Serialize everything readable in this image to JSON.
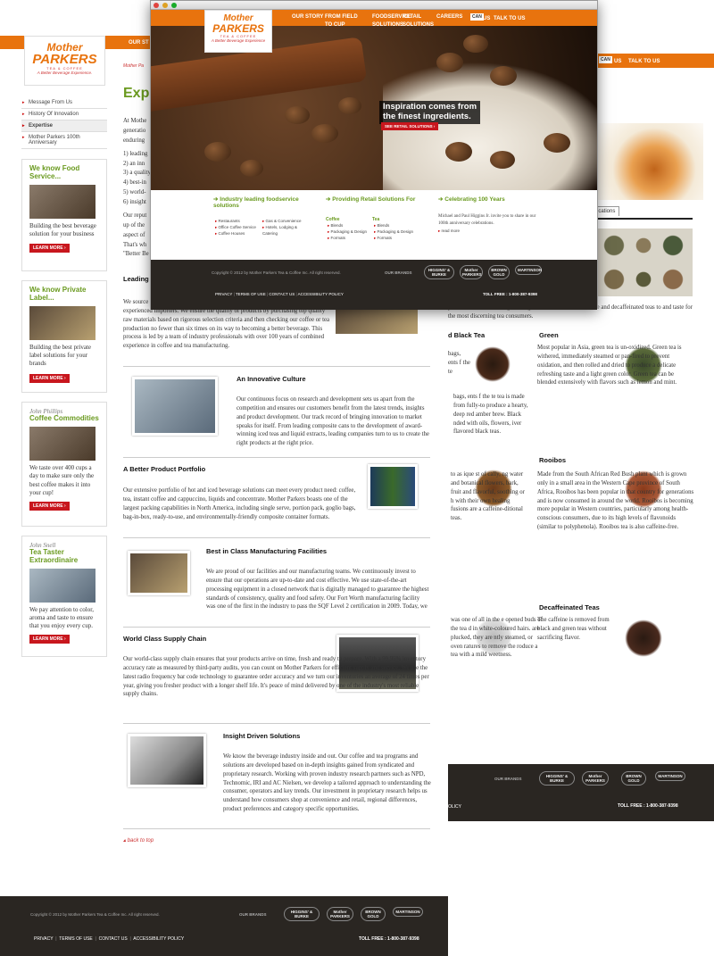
{
  "back_page": {
    "nav": {
      "our_story": "OUR ST",
      "can": "CAN",
      "us": "US",
      "talk": "TALK TO US"
    },
    "logo": {
      "line1": "Mother",
      "line2": "PARKERS",
      "line3": "TEA & COFFEE",
      "tagline": "A Better Beverage Experience."
    },
    "breadcrumb": "Mother Pa",
    "heading": "Expe",
    "side_menu": [
      "Message From Us",
      "History Of Innovation",
      "Expertise",
      "Mother Parkers 100th Anniversary"
    ],
    "promos": [
      {
        "title": "We know Food Service...",
        "who": "",
        "text": "Building the best beverage solution for your business",
        "btn": "LEARN MORE ›"
      },
      {
        "title": "We know Private Label...",
        "who": "",
        "text": "Building the best private label solutions for your brands",
        "btn": "LEARN MORE ›"
      },
      {
        "title": "Coffee Commodities",
        "who": "John Phillips",
        "text": "We taste over 400 cups a day to make sure only the best coffee makes it into your cup!",
        "btn": "LEARN MORE ›"
      },
      {
        "title": "Tea Taster Extraordinaire",
        "who": "John Snell",
        "text": "We pay attention to color, aroma and taste to ensure that you enjoy every cup.",
        "btn": "LEARN MORE ›"
      }
    ],
    "intro_lines": [
      "At Mothe",
      "generatio",
      "enduring",
      "1) leading",
      "2) an inn",
      "3) a quality",
      "4) best-in",
      "5) world-",
      "6) insight",
      "Our reput",
      "up of the",
      "aspect of",
      "That's wh",
      "\"Better Be"
    ],
    "leading_head": "Leading",
    "leading_text": "We source ... Mother Parkers chooses to deal with the most respected and experienced importers. We ensure the quality of products by purchasing top quality raw materials based on rigorous selection criteria and then checking our coffee or tea production no fewer than six times on its way to becoming a better beverage. This process is led by a team of industry professionals with over 100 years of combined experience in coffee and tea manufacturing.",
    "sections": [
      {
        "head": "An Innovative Culture",
        "text": "Our continuous focus on research and development sets us apart from the competition and ensures our customers benefit from the latest trends, insights and product development. Our track record of bringing innovation to market speaks for itself. From leading composite cans to the development of award-winning iced teas and liquid extracts, leading companies turn to us to create the right products at the right price."
      },
      {
        "head": "A Better Product Portfolio",
        "text": "Our extensive portfolio of hot and iced beverage solutions can meet every product need: coffee, tea, instant coffee and cappuccino, liquids and concentrate. Mother Parkers boasts one of the largest packing capabilities in North America, including single serve, portion pack, goglio bags, bag-in-box, ready-to-use, and environmentally-friendly composite container formats."
      },
      {
        "head": "Best in Class Manufacturing Facilities",
        "text": "We are proud of our facilities and our manufacturing teams. We continuously invest to ensure that our operations are up-to-date and cost effective. We use state-of-the-art processing equipment in a closed network that is digitally managed to guarantee the highest standards of consistency, quality and food safety. Our Fort Worth manufacturing facility was one of the first in the industry to pass the SQF Level 2 certification in 2009. Today, we are proud to provide this global quality recognition in each and every Mother Parkers facility."
      },
      {
        "head": "World Class Supply Chain",
        "text": "Our world-class supply chain ensures that your products arrive on time, fresh and ready to prepare. With a 99.95% inventory accuracy rate as measured by third-party audits, you can count on Mother Parkers for efficient supply and service. We use the latest radio frequency bar code technology to guarantee order accuracy and we turn our inventories an average of 24 times per year, giving you fresher product with a longer shelf life. It's peace of mind delivered by one of the industry's most reliable supply chains."
      },
      {
        "head": "Insight Driven Solutions",
        "text": "We know the beverage industry inside and out. Our coffee and tea programs and solutions are developed based on in-depth insights gained from syndicated and proprietary research. Working with proven industry research partners such as NPD, Technomic, IRI and AC Nielsen, we develop a tailored approach to understanding the consumer, operators and key trends. Our investment in proprietary research helps us understand how consumers shop at convenience and retail, regional differences, product preferences and category specific opportunities."
      }
    ],
    "back_to_top": "back to top",
    "footer": {
      "copy": "Copyright © 2012 by Mother Parkers Tea & Coffee Inc. All right reserved.",
      "our_brands": "OUR BRANDS",
      "links": [
        "PRIVACY",
        "TERMS OF USE",
        "CONTACT US",
        "ACCESSIBILITY POLICY"
      ],
      "toll": "TOLL FREE : 1-800-387-9398",
      "brands": [
        "HIGGINS' & BURKE",
        "Mother PARKERS",
        "BROWN GOLD",
        "MARTINSON"
      ]
    }
  },
  "right_page": {
    "nav": {
      "can": "CAN",
      "us": "US",
      "talk": "TALK TO US"
    },
    "tab": "ications",
    "intro": "y and science of blending black, green, herbals, rooibos, white and decaffeinated teas to and taste for the most discerning tea consumers.",
    "black_head": "d Black Tea",
    "black_text": "bags, ents f the te tea is made from fully-to produce a hearty, deep red amber brew. Black nded with oils, flowers, iver flavored black teas.",
    "green_head": "Green",
    "green_text": "Most popular in Asia, green tea is un-oxidized. Green tea is withered, immediately steamed or pan-fired to prevent oxidation, and then rolled and dried to produce a delicate refreshing taste and a light green color. Green tea can be blended extensively with flavors such as lemon and mint.",
    "herbal_text": "to as ique st of cally, ng water and botanical flowers, bark, fruit and flavorful, soothing or h with their own healing fusions are a caffeine-ditional teas.",
    "rooibos_head": "Rooibos",
    "rooibos_text": "Made from the South African Red Bush plant which is grown only in a small area in the Western Cape province of South Africa, Rooibos has been popular in that country for generations and is now consumed in around the world. Rooibos is becoming more popular in Western countries, particularly among health-conscious consumers, due to its high levels of flavonoids (similar to polyphenola). Rooibos tea is also caffeine-free.",
    "white_text": "was one of all in the e opened buds of the tea d in white-coloured hairs. are plucked, they are ntly steamed, or oven ratures to remove the roduce a tea with a mild weetness.",
    "decaf_head": "Decaffeinated Teas",
    "decaf_text": "The caffeine is removed from black and green teas without sacrificing flavor.",
    "footer": {
      "our_brands": "OUR BRANDS",
      "links": "OLICY",
      "toll": "TOLL FREE : 1-800-387-9398",
      "brands": [
        "HIGGINS' & BURKE",
        "Mother PARKERS",
        "BROWN GOLD",
        "MARTINSON"
      ]
    }
  },
  "front_page": {
    "nav": [
      "OUR STORY",
      "FROM FIELD TO CUP",
      "FOODSERVICE SOLUTIONS",
      "RETAIL SOLUTIONS",
      "CAREERS"
    ],
    "lang": {
      "can": "CAN",
      "us": "US",
      "talk": "TALK TO US"
    },
    "logo": {
      "line1": "Mother",
      "line2": "PARKERS",
      "line3": "TEA & COFFEE",
      "tagline": "A Better Beverage Experience"
    },
    "hero": {
      "line1": "Inspiration comes from",
      "line2": "the finest ingredients.",
      "btn": "SEE RETAIL SOLUTIONS ›"
    },
    "col1": {
      "title": "Industry leading foodservice solutions",
      "a": [
        "Restaurants",
        "Office Coffee Service",
        "Coffee Houses"
      ],
      "b": [
        "Gas & Convenience",
        "Hotels, Lodging & Catering"
      ]
    },
    "col2": {
      "title": "Providing Retail Solutions For",
      "coffee": "Coffee",
      "tea": "Tea",
      "a": [
        "Blends",
        "Packaging & Design",
        "Formats"
      ],
      "b": [
        "Blends",
        "Packaging & Design",
        "Formats"
      ]
    },
    "col3": {
      "title": "Celebrating 100 Years",
      "text": "Michael and Paul Higgins Jr. invite you to share in our 100th anniversary celebrations.",
      "more": "read more"
    },
    "footer": {
      "copy": "Copyright © 2012 by Mother Parkers Tea & Coffee Inc. All right reserved.",
      "our_brands": "OUR BRANDS",
      "links": [
        "PRIVACY",
        "TERMS OF USE",
        "CONTACT US",
        "ACCESSIBILITY POLICY"
      ],
      "toll": "TOLL FREE : 1-800-387-9398",
      "brands": [
        "HIGGINS' & BURKE",
        "Mother PARKERS",
        "BROWN GOLD",
        "MARTINSON"
      ]
    }
  }
}
